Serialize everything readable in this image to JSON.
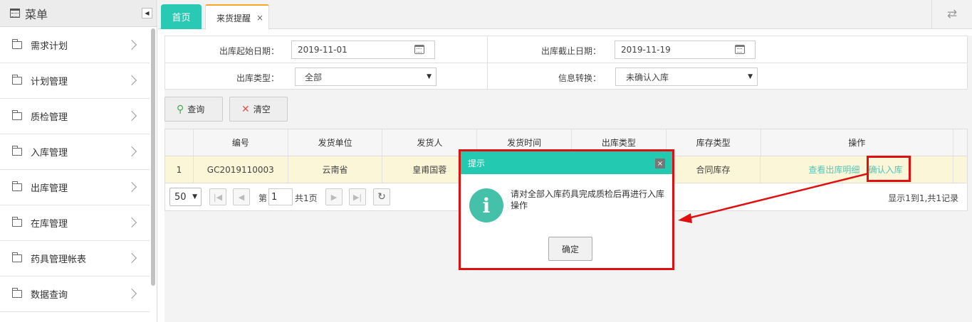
{
  "sidebar": {
    "title": "菜单",
    "items": [
      {
        "label": "需求计划"
      },
      {
        "label": "计划管理"
      },
      {
        "label": "质检管理"
      },
      {
        "label": "入库管理"
      },
      {
        "label": "出库管理"
      },
      {
        "label": "在库管理"
      },
      {
        "label": "药具管理帐表"
      },
      {
        "label": "数据查询"
      }
    ]
  },
  "tabs": {
    "home": "首页",
    "active": "来货提醒",
    "close": "×"
  },
  "filter": {
    "start_label": "出库起始日期：",
    "start_value": "2019-11-01",
    "end_label": "出库截止日期：",
    "end_value": "2019-11-19",
    "type_label": "出库类型：",
    "type_value": "全部",
    "convert_label": "信息转换：",
    "convert_value": "未确认入库"
  },
  "buttons": {
    "query": "查询",
    "clear": "清空"
  },
  "table": {
    "headers": [
      "编号",
      "发货单位",
      "发货人",
      "发货时间",
      "出库类型",
      "库存类型",
      "操作"
    ],
    "rows": [
      {
        "index": "1",
        "code": "GC2019110003",
        "unit": "云南省",
        "sender": "皇甫国蓉",
        "time": "",
        "out_type": "",
        "stock_type": "合同库存",
        "action_view": "查看出库明细",
        "action_confirm": "确认入库"
      }
    ]
  },
  "pager": {
    "page_size": "50",
    "page_prefix": "第",
    "page_value": "1",
    "page_total": "共1页",
    "info": "显示1到1,共1记录"
  },
  "dialog": {
    "title": "提示",
    "close": "×",
    "icon": "i",
    "message": "请对全部入库药具完成质检后再进行入库操作",
    "ok": "确定"
  },
  "colors": {
    "accent": "#2ac9b4",
    "highlight": "#e01010",
    "row_highlight": "#fbf6d8"
  }
}
